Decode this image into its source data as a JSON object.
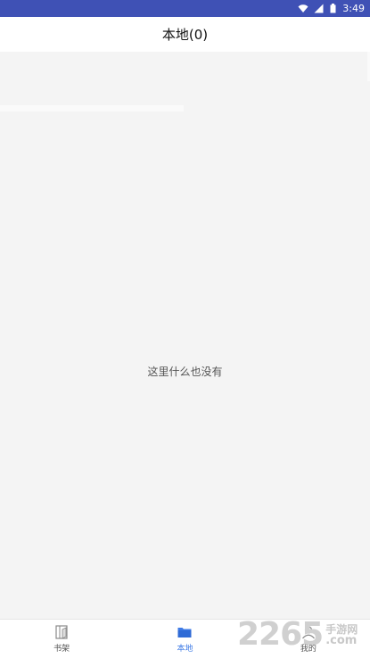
{
  "status_bar": {
    "time": "3:49",
    "icons": [
      "wifi-icon",
      "signal-icon",
      "battery-icon"
    ],
    "background": "#3f51b5"
  },
  "header": {
    "title": "本地(0)"
  },
  "main": {
    "empty_message": "这里什么也没有"
  },
  "bottom_nav": {
    "items": [
      {
        "label": "书架",
        "icon": "bookshelf-icon",
        "active": false
      },
      {
        "label": "本地",
        "icon": "folder-icon",
        "active": true
      },
      {
        "label": "我的",
        "icon": "user-icon",
        "active": false
      }
    ],
    "active_color": "#3f7be6"
  },
  "watermark": {
    "number": "2265",
    "site_name": "手游网",
    "domain": ".com"
  }
}
